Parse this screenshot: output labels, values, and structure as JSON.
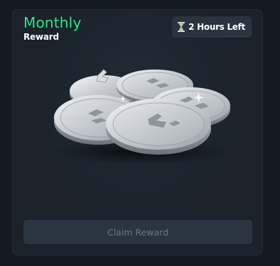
{
  "reward": {
    "title": "Monthly",
    "subtitle": "Reward",
    "time_badge": {
      "icon": "hourglass-icon",
      "label": "2 Hours Left"
    },
    "artwork": "silver-coins-pile",
    "claim_button_label": "Claim Reward"
  },
  "colors": {
    "background": "#141a21",
    "card": "#1b222a",
    "accent_green": "#2fe68a",
    "badge_bg": "#2b333e",
    "button_bg": "#2b3441",
    "button_text": "#6a7584",
    "hourglass_sand": "#e8c75a"
  }
}
